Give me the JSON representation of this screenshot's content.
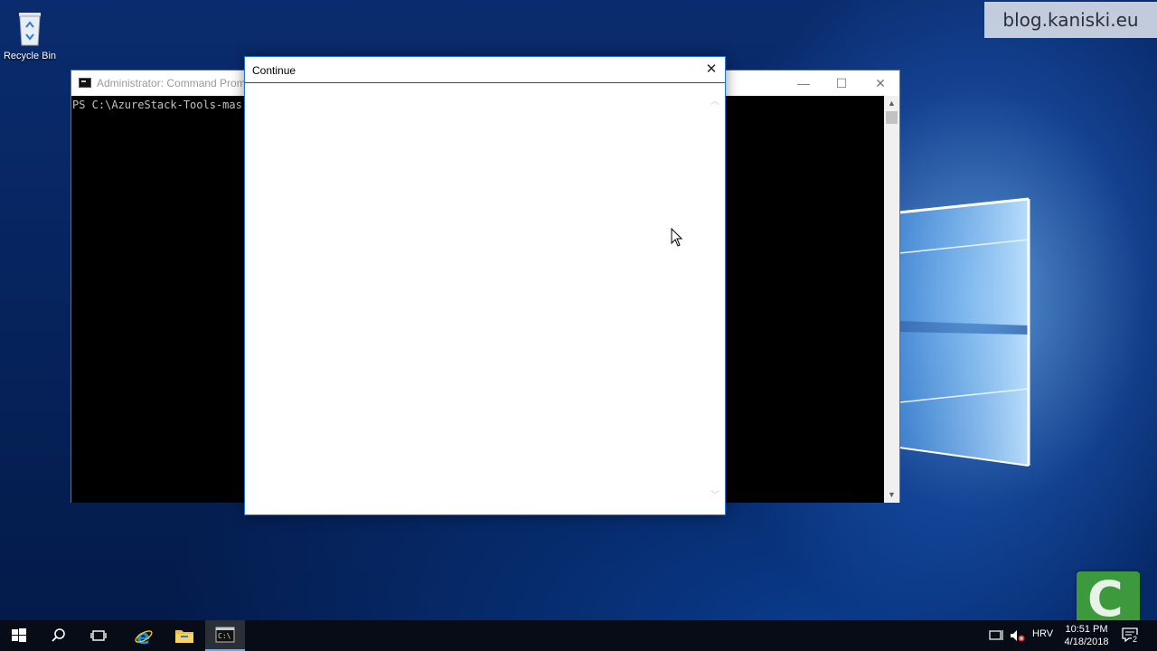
{
  "desktop": {
    "icons": [
      {
        "label": "Recycle Bin",
        "icon": "recycle-bin-icon"
      }
    ],
    "watermark": "blog.kaniski.eu",
    "badge_letter": "C"
  },
  "cmd_window": {
    "title": "Administrator: Command Promp",
    "console_text": "PS C:\\AzureStack-Tools-mas",
    "controls": {
      "minimize": "—",
      "maximize": "☐",
      "close": "✕"
    }
  },
  "dialog": {
    "title": "Continue",
    "close_glyph": "✕"
  },
  "taskbar": {
    "pinned": [
      {
        "name": "start",
        "icon": "windows-start-icon"
      },
      {
        "name": "search",
        "icon": "search-icon"
      },
      {
        "name": "task-view",
        "icon": "task-view-icon"
      },
      {
        "name": "internet-explorer",
        "icon": "internet-explorer-icon"
      },
      {
        "name": "file-explorer",
        "icon": "file-explorer-icon"
      },
      {
        "name": "command-prompt",
        "icon": "command-prompt-icon"
      }
    ],
    "tray": {
      "language": "HRV",
      "time": "10:51 PM",
      "date": "4/18/2018",
      "notifications_count": "2"
    }
  },
  "colors": {
    "dialog_border": "#1c76d0",
    "taskbar": "#070c16",
    "badge": "#3c9a3c"
  }
}
